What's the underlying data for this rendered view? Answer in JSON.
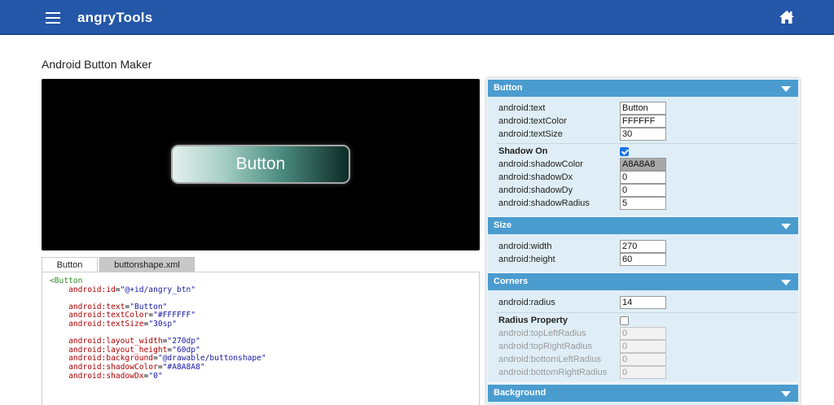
{
  "topbar": {
    "brand": "angryTools",
    "menu_icon": "hamburger-menu-icon",
    "home_icon": "home-icon",
    "color": "#2457a8"
  },
  "page": {
    "title": "Android Button Maker"
  },
  "preview": {
    "button_label": "Button",
    "background": "#000000"
  },
  "tabs": [
    {
      "label": "Button",
      "active": true
    },
    {
      "label": "buttonshape.xml",
      "active": false
    }
  ],
  "code": {
    "open_tag": "<Button",
    "lines": [
      {
        "attr": "android:id",
        "val": "\"@+id/angry_btn\""
      },
      {
        "gap": true
      },
      {
        "attr": "android:text",
        "val": "\"Button\""
      },
      {
        "attr": "android:textColor",
        "val": "\"#FFFFFF\""
      },
      {
        "attr": "android:textSize",
        "val": "\"30sp\""
      },
      {
        "gap": true
      },
      {
        "attr": "android:layout_width",
        "val": "\"270dp\""
      },
      {
        "attr": "android:layout_height",
        "val": "\"60dp\""
      },
      {
        "attr": "android:background",
        "val": "\"@drawable/buttonshape\""
      },
      {
        "attr": "android:shadowColor",
        "val": "\"#A8A8A8\""
      },
      {
        "attr": "android:shadowDx",
        "val": "\"0\""
      }
    ]
  },
  "panel": {
    "button": {
      "header": "Button",
      "text_label": "android:text",
      "text_value": "Button",
      "textcolor_label": "android:textColor",
      "textcolor_value": "FFFFFF",
      "textsize_label": "android:textSize",
      "textsize_value": "30",
      "shadow_on_label": "Shadow On",
      "shadow_on": true,
      "shadowcolor_label": "android:shadowColor",
      "shadowcolor_value": "A8A8A8",
      "shadowdx_label": "android:shadowDx",
      "shadowdx_value": "0",
      "shadowdy_label": "android:shadowDy",
      "shadowdy_value": "0",
      "shadowradius_label": "android:shadowRadius",
      "shadowradius_value": "5"
    },
    "size": {
      "header": "Size",
      "width_label": "android:width",
      "width_value": "270",
      "height_label": "android:height",
      "height_value": "60"
    },
    "corners": {
      "header": "Corners",
      "radius_label": "android:radius",
      "radius_value": "14",
      "radius_property_label": "Radius Property",
      "radius_property": false,
      "topleft_label": "android:topLeftRadius",
      "topleft_value": "0",
      "topright_label": "android:topRightRadius",
      "topright_value": "0",
      "bottomleft_label": "android:bottomLeftRadius",
      "bottomleft_value": "0",
      "bottomright_label": "android:bottomRightRadius",
      "bottomright_value": "0"
    },
    "background": {
      "header": "Background"
    }
  }
}
